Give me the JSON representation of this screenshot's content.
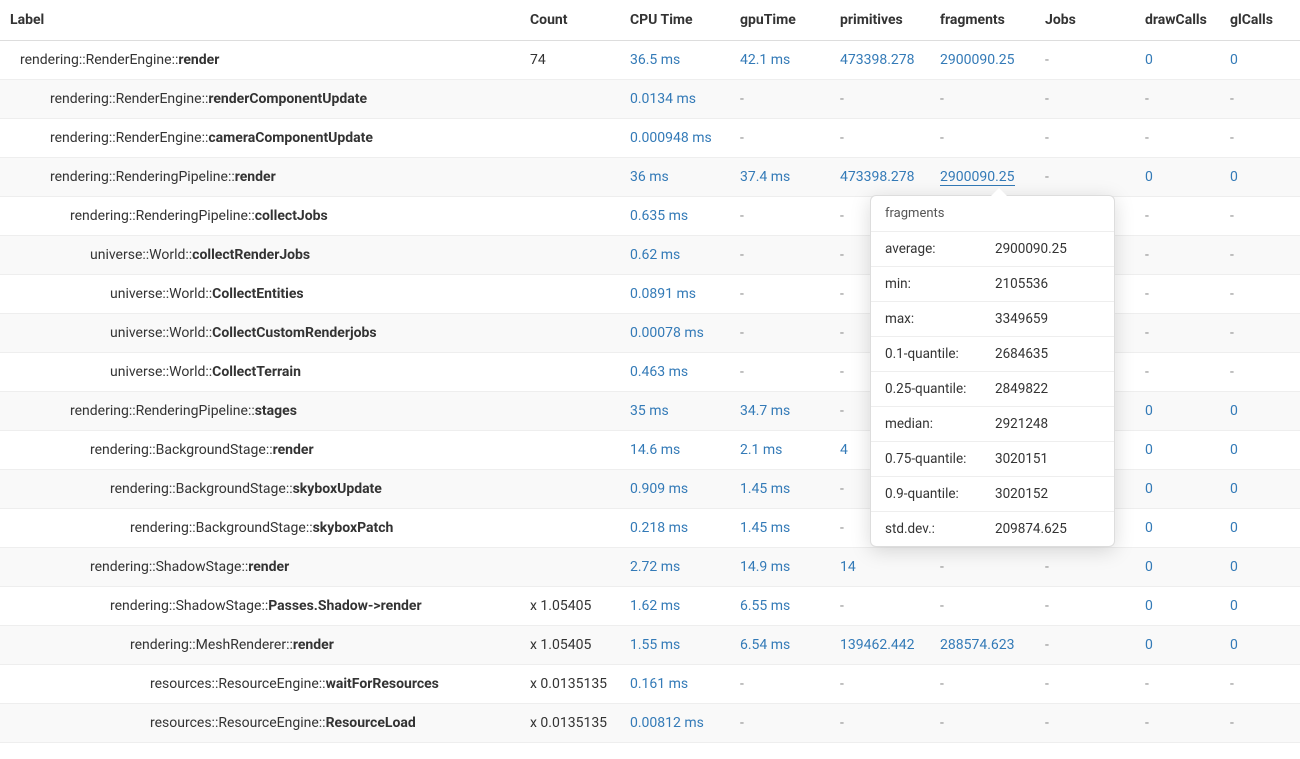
{
  "headers": {
    "label": "Label",
    "count": "Count",
    "cpuTime": "CPU Time",
    "gpuTime": "gpuTime",
    "primitives": "primitives",
    "fragments": "fragments",
    "jobs": "Jobs",
    "drawCalls": "drawCalls",
    "glCalls": "glCalls"
  },
  "rows": [
    {
      "indent": 0,
      "ns": "rendering::RenderEngine::",
      "fn": "render",
      "count": "74",
      "cpu": "36.5 ms",
      "gpu": "42.1 ms",
      "prim": "473398.278",
      "frag": "2900090.25",
      "jobs": "-",
      "draw": "0",
      "gl": "0"
    },
    {
      "indent": 1,
      "ns": "rendering::RenderEngine::",
      "fn": "renderComponentUpdate",
      "count": "",
      "cpu": "0.0134 ms",
      "gpu": "-",
      "prim": "-",
      "frag": "-",
      "jobs": "-",
      "draw": "-",
      "gl": "-"
    },
    {
      "indent": 1,
      "ns": "rendering::RenderEngine::",
      "fn": "cameraComponentUpdate",
      "count": "",
      "cpu": "0.000948 ms",
      "gpu": "-",
      "prim": "-",
      "frag": "-",
      "jobs": "-",
      "draw": "-",
      "gl": "-"
    },
    {
      "indent": 1,
      "ns": "rendering::RenderingPipeline::",
      "fn": "render",
      "count": "",
      "cpu": "36 ms",
      "gpu": "37.4 ms",
      "prim": "473398.278",
      "frag": "2900090.25",
      "fragTooltip": true,
      "jobs": "-",
      "draw": "0",
      "gl": "0"
    },
    {
      "indent": 2,
      "ns": "rendering::RenderingPipeline::",
      "fn": "collectJobs",
      "count": "",
      "cpu": "0.635 ms",
      "gpu": "-",
      "prim": "-",
      "frag": "-",
      "jobs": "-",
      "draw": "-",
      "gl": "-"
    },
    {
      "indent": 3,
      "ns": "universe::World::",
      "fn": "collectRenderJobs",
      "count": "",
      "cpu": "0.62 ms",
      "gpu": "-",
      "prim": "-",
      "frag": "-",
      "jobs": "-",
      "draw": "-",
      "gl": "-"
    },
    {
      "indent": 4,
      "ns": "universe::World::",
      "fn": "CollectEntities",
      "count": "",
      "cpu": "0.0891 ms",
      "gpu": "-",
      "prim": "-",
      "frag": "-",
      "jobs": "-",
      "draw": "-",
      "gl": "-"
    },
    {
      "indent": 4,
      "ns": "universe::World::",
      "fn": "CollectCustomRenderjobs",
      "count": "",
      "cpu": "0.00078 ms",
      "gpu": "-",
      "prim": "-",
      "frag": "-",
      "jobs": "-",
      "draw": "-",
      "gl": "-"
    },
    {
      "indent": 4,
      "ns": "universe::World::",
      "fn": "CollectTerrain",
      "count": "",
      "cpu": "0.463 ms",
      "gpu": "-",
      "prim": "-",
      "frag": "-",
      "jobs": "-",
      "draw": "-",
      "gl": "-"
    },
    {
      "indent": 2,
      "ns": "rendering::RenderingPipeline::",
      "fn": "stages",
      "count": "",
      "cpu": "35 ms",
      "gpu": "34.7 ms",
      "prim": "-",
      "frag": "-",
      "jobs": "-",
      "draw": "0",
      "gl": "0"
    },
    {
      "indent": 3,
      "ns": "rendering::BackgroundStage::",
      "fn": "render",
      "count": "",
      "cpu": "14.6 ms",
      "gpu": "2.1 ms",
      "prim": "4",
      "frag": "-",
      "jobs": "-",
      "draw": "0",
      "gl": "0"
    },
    {
      "indent": 4,
      "ns": "rendering::BackgroundStage::",
      "fn": "skyboxUpdate",
      "count": "",
      "cpu": "0.909 ms",
      "gpu": "1.45 ms",
      "prim": "-",
      "frag": "-",
      "jobs": "-",
      "draw": "0",
      "gl": "0"
    },
    {
      "indent": 5,
      "ns": "rendering::BackgroundStage::",
      "fn": "skyboxPatch",
      "count": "",
      "cpu": "0.218 ms",
      "gpu": "1.45 ms",
      "prim": "-",
      "frag": "-",
      "jobs": "-",
      "draw": "0",
      "gl": "0"
    },
    {
      "indent": 3,
      "ns": "rendering::ShadowStage::",
      "fn": "render",
      "count": "",
      "cpu": "2.72 ms",
      "gpu": "14.9 ms",
      "prim": "14",
      "frag": "-",
      "jobs": "-",
      "draw": "0",
      "gl": "0"
    },
    {
      "indent": 4,
      "ns": "rendering::ShadowStage::",
      "fn": "Passes.Shadow->render",
      "count": "x 1.05405",
      "cpu": "1.62 ms",
      "gpu": "6.55 ms",
      "prim": "-",
      "frag": "-",
      "jobs": "-",
      "draw": "0",
      "gl": "0"
    },
    {
      "indent": 5,
      "ns": "rendering::MeshRenderer::",
      "fn": "render",
      "count": "x 1.05405",
      "cpu": "1.55 ms",
      "gpu": "6.54 ms",
      "prim": "139462.442",
      "frag": "288574.623",
      "jobs": "-",
      "draw": "0",
      "gl": "0"
    },
    {
      "indent": 6,
      "ns": "resources::ResourceEngine::",
      "fn": "waitForResources",
      "count": "x 0.0135135",
      "cpu": "0.161 ms",
      "gpu": "-",
      "prim": "-",
      "frag": "-",
      "jobs": "-",
      "draw": "-",
      "gl": "-"
    },
    {
      "indent": 6,
      "ns": "resources::ResourceEngine::",
      "fn": "ResourceLoad",
      "count": "x 0.0135135",
      "cpu": "0.00812 ms",
      "gpu": "-",
      "prim": "-",
      "frag": "-",
      "jobs": "-",
      "draw": "-",
      "gl": "-"
    }
  ],
  "tooltip": {
    "title": "fragments",
    "rows": [
      {
        "key": "average:",
        "val": "2900090.25"
      },
      {
        "key": "min:",
        "val": "2105536"
      },
      {
        "key": "max:",
        "val": "3349659"
      },
      {
        "key": "0.1-quantile:",
        "val": "2684635"
      },
      {
        "key": "0.25-quantile:",
        "val": "2849822"
      },
      {
        "key": "median:",
        "val": "2921248"
      },
      {
        "key": "0.75-quantile:",
        "val": "3020151"
      },
      {
        "key": "0.9-quantile:",
        "val": "3020152"
      },
      {
        "key": "std.dev.:",
        "val": "209874.625"
      }
    ]
  }
}
